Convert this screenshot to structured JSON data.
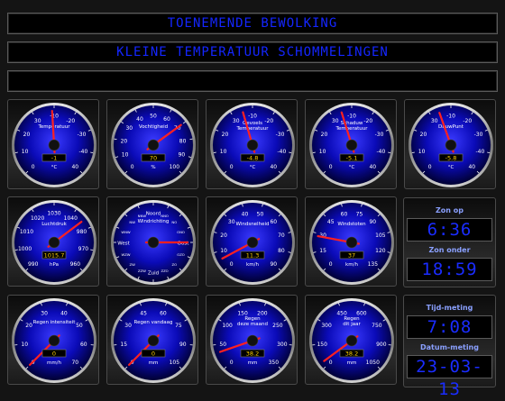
{
  "banners": [
    "TOENEMENDE BEWOLKING",
    "KLEINE TEMPERATUUR SCHOMMELINGEN",
    ""
  ],
  "colors": {
    "accent": "#1426ff",
    "needle": "#ff2020",
    "face": "#0a0ab0"
  },
  "gauges": [
    {
      "label": [
        "Temperatuur"
      ],
      "ticks": [
        "0",
        "10",
        "20",
        "30",
        "-10",
        "-20",
        "-30",
        "-40",
        "40"
      ],
      "unit": "°C",
      "value": "-1",
      "needle": -1,
      "min": -40,
      "max": 40
    },
    {
      "label": [
        "Vochtigheid"
      ],
      "ticks": [
        "0",
        "10",
        "20",
        "30",
        "40",
        "50",
        "60",
        "70",
        "80",
        "90",
        "100"
      ],
      "unit": "%",
      "value": "70",
      "needle": 70,
      "min": 0,
      "max": 100
    },
    {
      "label": [
        "Gevoels",
        "Temperatuur"
      ],
      "ticks": [
        "0",
        "10",
        "20",
        "30",
        "-10",
        "-20",
        "-30",
        "-40",
        "40"
      ],
      "unit": "°C",
      "value": "-4.8",
      "needle": -4.8,
      "min": -40,
      "max": 40
    },
    {
      "label": [
        "Schaduw",
        "Temperatuur"
      ],
      "ticks": [
        "0",
        "10",
        "20",
        "30",
        "-10",
        "-20",
        "-30",
        "-40",
        "40"
      ],
      "unit": "°C",
      "value": "-5.1",
      "needle": -5.1,
      "min": -40,
      "max": 40
    },
    {
      "label": [
        "DauwPunt"
      ],
      "ticks": [
        "0",
        "10",
        "20",
        "30",
        "-10",
        "-20",
        "-30",
        "-40",
        "40"
      ],
      "unit": "°C",
      "value": "-5.8",
      "needle": -5.8,
      "min": -40,
      "max": 40
    },
    {
      "label": [
        "Luchtdruk"
      ],
      "ticks": [
        "990",
        "1000",
        "1010",
        "1020",
        "1030",
        "1040",
        "980",
        "970",
        "960"
      ],
      "unit": "hPa",
      "value": "1015.7",
      "needle": 1015.7,
      "min": 960,
      "max": 1040
    },
    {
      "label": [
        "Windrichting"
      ],
      "ticks": [
        "Noord",
        "NNO",
        "NO",
        "ONO",
        "Oost",
        "OZO",
        "ZO",
        "ZZO",
        "Zuid",
        "ZZW",
        "ZW",
        "WZW",
        "West",
        "WNW",
        "NW",
        "NNW"
      ],
      "unit": "",
      "value": "",
      "needle": 90,
      "min": 0,
      "max": 360
    },
    {
      "label": [
        "Windsnelheid"
      ],
      "ticks": [
        "0",
        "10",
        "20",
        "30",
        "40",
        "50",
        "60",
        "70",
        "80",
        "90"
      ],
      "unit": "km/h",
      "value": "11.3",
      "needle": 11.3,
      "min": 0,
      "max": 180
    },
    {
      "label": [
        "Windstoten"
      ],
      "ticks": [
        "0",
        "15",
        "30",
        "45",
        "60",
        "75",
        "90",
        "105",
        "120",
        "135"
      ],
      "unit": "km/h",
      "value": "37",
      "needle": 37,
      "min": 0,
      "max": 180
    },
    {
      "label": [
        "Regen intensiteit"
      ],
      "ticks": [
        "0",
        "10",
        "20",
        "30",
        "40",
        "50",
        "60",
        "70"
      ],
      "unit": "mm/h",
      "value": "0",
      "needle": 0,
      "min": 0,
      "max": 80
    },
    {
      "label": [
        "Regen vandaag"
      ],
      "ticks": [
        "0",
        "15",
        "30",
        "45",
        "60",
        "75",
        "90",
        "105"
      ],
      "unit": "mm",
      "value": "0",
      "needle": 0,
      "min": 0,
      "max": 120
    },
    {
      "label": [
        "Regen",
        "deze maand"
      ],
      "ticks": [
        "0",
        "50",
        "100",
        "150",
        "200",
        "250",
        "300",
        "350"
      ],
      "unit": "mm",
      "value": "38.2",
      "needle": 38.2,
      "min": 0,
      "max": 400
    },
    {
      "label": [
        "Regen",
        "dit jaar"
      ],
      "ticks": [
        "0",
        "150",
        "300",
        "450",
        "600",
        "750",
        "900",
        "1050"
      ],
      "unit": "mm",
      "value": "38.2",
      "needle": 38.2,
      "min": 0,
      "max": 1200
    }
  ],
  "side": {
    "zon_op_label": "Zon op",
    "zon_op": "6:36",
    "zon_onder_label": "Zon onder",
    "zon_onder": "18:59",
    "tijd_label": "Tijd-meting",
    "tijd": "7:08",
    "datum_label": "Datum-meting",
    "datum": "23-03-13"
  }
}
